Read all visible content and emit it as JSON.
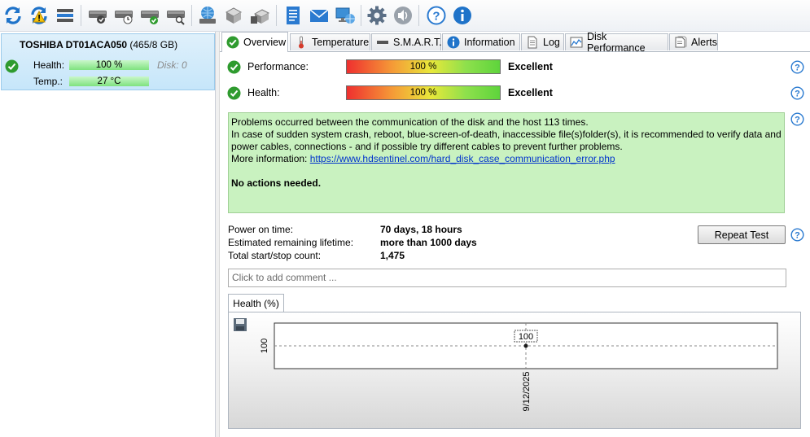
{
  "toolbar": {
    "buttons": [
      {
        "name": "refresh-icon",
        "tip": "Refresh"
      },
      {
        "name": "refresh-warning-icon",
        "tip": "Refresh with warning"
      },
      {
        "name": "disk-list-icon",
        "tip": "Disk list"
      },
      {
        "name": "disk-test-icon",
        "tip": "Disk test"
      },
      {
        "name": "disk-schedule-icon",
        "tip": "Scheduled test"
      },
      {
        "name": "disk-ok-icon",
        "tip": "Disk status"
      },
      {
        "name": "disk-search-icon",
        "tip": "Disk search"
      },
      {
        "name": "network-disk-icon",
        "tip": "Network"
      },
      {
        "name": "backup-icon",
        "tip": "Backup"
      },
      {
        "name": "disk-export-icon",
        "tip": "Export"
      },
      {
        "name": "report-icon",
        "tip": "Report"
      },
      {
        "name": "email-icon",
        "tip": "Email"
      },
      {
        "name": "monitor-icon",
        "tip": "Monitor"
      },
      {
        "name": "settings-gear-icon",
        "tip": "Settings"
      },
      {
        "name": "sound-icon",
        "tip": "Sound"
      },
      {
        "name": "help-icon",
        "tip": "Help"
      },
      {
        "name": "info-icon",
        "tip": "Info"
      }
    ]
  },
  "disk": {
    "name": "TOSHIBA DT01ACA050",
    "size": "(465/8 GB)",
    "health_label": "Health:",
    "health_value": "100 %",
    "health_level": 1.0,
    "temp_label": "Temp.:",
    "temp_value": "27 °C",
    "index": "Disk: 0"
  },
  "tabs": [
    {
      "label": "Overview",
      "icon": "check-icon",
      "active": true
    },
    {
      "label": "Temperature",
      "icon": "thermometer-icon",
      "active": false
    },
    {
      "label": "S.M.A.R.T.",
      "icon": "smart-bar-icon",
      "active": false
    },
    {
      "label": "Information",
      "icon": "information-icon",
      "active": false
    },
    {
      "label": "Log",
      "icon": "log-document-icon",
      "active": false
    },
    {
      "label": "Disk Performance",
      "icon": "performance-chart-icon",
      "active": false
    },
    {
      "label": "Alerts",
      "icon": "alerts-icon",
      "active": false
    }
  ],
  "overview": {
    "performance_label": "Performance:",
    "performance_value": "100 %",
    "performance_level": 1.0,
    "performance_rating": "Excellent",
    "health_label": "Health:",
    "health_value": "100 %",
    "health_level": 1.0,
    "health_rating": "Excellent",
    "message": {
      "line1": "Problems occurred between the communication of the disk and the host 113 times.",
      "line2": "In case of sudden system crash, reboot, blue-screen-of-death, inaccessible file(s)folder(s), it is recommended to verify data and power cables, connections - and if possible try different cables to prevent further problems.",
      "more_prefix": "More information: ",
      "more_link": "https://www.hdsentinel.com/hard_disk_case_communication_error.php",
      "actions": "No actions needed."
    },
    "power_on_label": "Power on time:",
    "power_on_value": "70 days, 18 hours",
    "lifetime_label": "Estimated remaining lifetime:",
    "lifetime_value": "more than 1000 days",
    "startstop_label": "Total start/stop count:",
    "startstop_value": "1,475",
    "repeat_button": "Repeat Test",
    "comment_placeholder": "Click to add comment ..."
  },
  "chart_tab": "Health (%)",
  "chart_data": {
    "type": "line",
    "x": [
      "9/12/2025"
    ],
    "series": [
      {
        "values": [
          100
        ]
      }
    ],
    "y_tick_labels": [
      "100"
    ],
    "x_tick_labels": [
      "9/12/2025"
    ],
    "data_labels": [
      "100"
    ],
    "grid": true
  },
  "colors": {
    "accent": "#2a7ad0",
    "ok_green": "#2f9b2f",
    "message_bg": "#c9f2c0",
    "link": "#0033cc"
  }
}
